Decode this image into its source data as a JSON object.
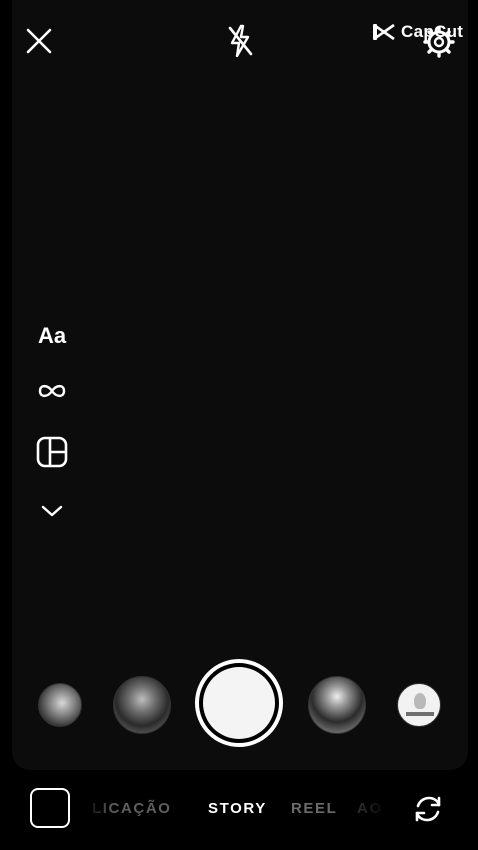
{
  "watermark": {
    "text": "CapCut",
    "icon": "capcut-logo-icon"
  },
  "top_bar": {
    "close_icon": "close-icon",
    "flash_icon": "flash-off-icon",
    "settings_icon": "settings-gear-icon"
  },
  "tools": {
    "text_label": "Aa",
    "boomerang_icon": "infinity-icon",
    "layout_icon": "layout-grid-icon",
    "more_icon": "chevron-down-icon"
  },
  "capture": {
    "recent_thumbnails": 4,
    "shutter": "shutter-button"
  },
  "bottom_bar": {
    "gallery_icon": "gallery-icon",
    "modes": [
      {
        "label": "LICAÇÃO",
        "selected": false
      },
      {
        "label": "STORY",
        "selected": true
      },
      {
        "label": "REEL",
        "selected": false
      },
      {
        "label": "AO",
        "selected": false
      }
    ],
    "flip_camera_icon": "flip-camera-icon"
  },
  "colors": {
    "background": "#000000",
    "viewfinder": "#0c0c0c",
    "active_text": "#ffffff",
    "inactive_text": "#6b6b6b"
  }
}
